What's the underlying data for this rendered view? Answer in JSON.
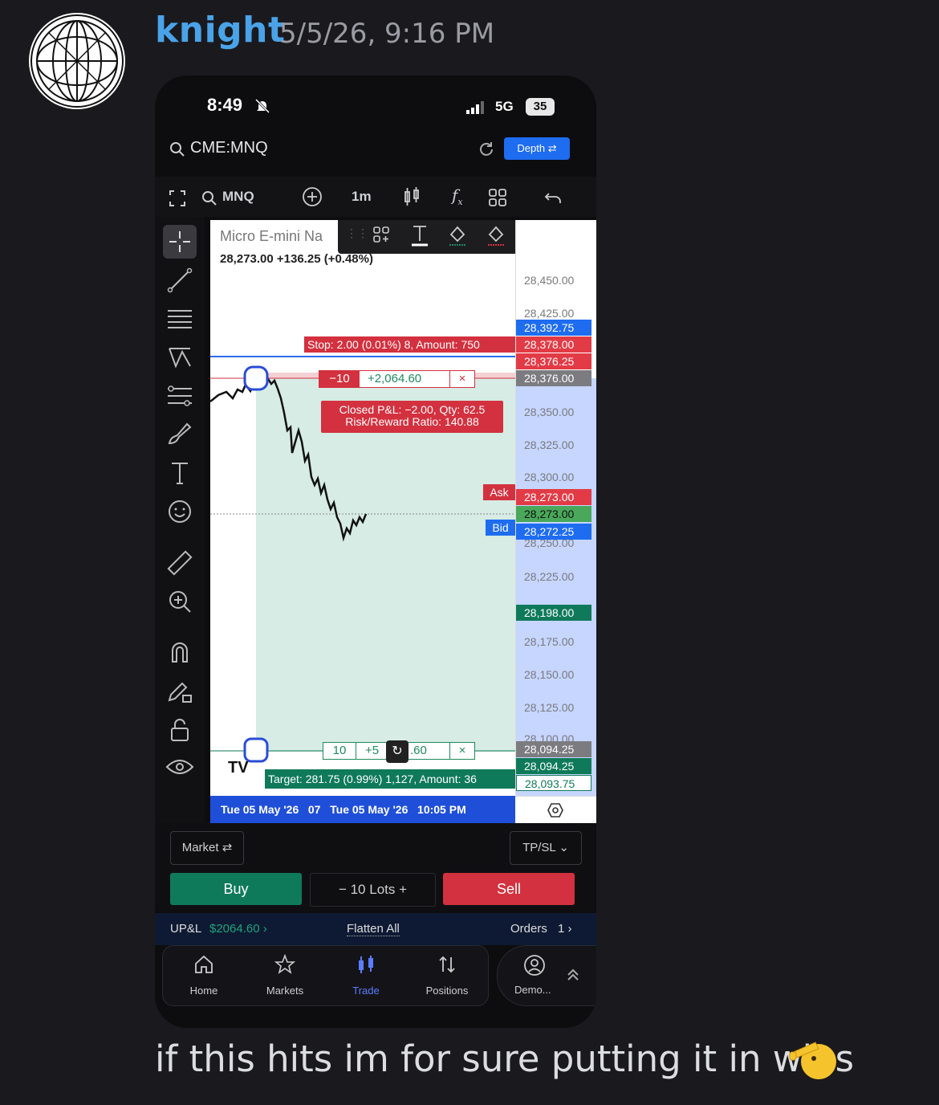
{
  "message": {
    "username": "knight",
    "timestamp": "5/5/26, 9:16 PM",
    "text": "if this hits im for sure putting it in wins"
  },
  "phone": {
    "status": {
      "time": "8:49",
      "network": "5G",
      "battery": "35"
    },
    "header": {
      "symbol": "CME:MNQ",
      "depth_label": "Depth"
    },
    "toolbar": {
      "symbol": "MNQ",
      "interval": "1m"
    },
    "chart": {
      "title": "Micro E-mini Na",
      "quote": "28,273.00 +136.25 (+0.48%)",
      "price_ticks": [
        "28,450.00",
        "28,425.00",
        "28,350.00",
        "28,325.00",
        "28,300.00",
        "28,250.00",
        "28,225.00",
        "28,175.00",
        "28,150.00",
        "28,125.00",
        "28,100.00"
      ],
      "tags": {
        "blue_line": "28,392.75",
        "stop": "28,378.00",
        "stop2": "28,376.25",
        "entry": "28,376.00",
        "ask": "28,273.00",
        "last": "28,273.00",
        "bid": "28,272.25",
        "level": "28,198.00",
        "target_gray": "28,094.25",
        "target_green": "28,094.25",
        "target_outline": "28,093.75"
      },
      "ask_label": "Ask",
      "bid_label": "Bid",
      "stop_label": "Stop: 2.00 (0.01%) 8, Amount: 750",
      "position_qty": "−10",
      "position_pnl": "+2,064.60",
      "closed_pnl_line1": "Closed P&L: −2.00, Qty: 62.5",
      "closed_pnl_line2": "Risk/Reward Ratio: 140.88",
      "target_qty": "10",
      "target_pnl_a": "+5",
      "target_pnl_b": ".60",
      "target_label": "Target: 281.75 (0.99%) 1,127, Amount: 36",
      "date_bar": "Tue 05 May '26   07   Tue 05 May '26   10:05 PM"
    },
    "order": {
      "market_label": "Market ⇄",
      "tpsl_label": "TP/SL ⌄",
      "buy_label": "Buy",
      "lots_label": "−   10  Lots  +",
      "sell_label": "Sell"
    },
    "pnl_bar": {
      "upnl_label": "UP&L",
      "upnl_value": "$2064.60 ›",
      "flatten_label": "Flatten All",
      "orders_label": "Orders",
      "orders_count": "1 ›"
    },
    "nav": {
      "home": "Home",
      "markets": "Markets",
      "trade": "Trade",
      "positions": "Positions",
      "demo": "Demo..."
    }
  },
  "colors": {
    "username": "#4aa3e8",
    "buy": "#0f7a5a",
    "sell": "#d3313f",
    "accent_blue": "#1e6cf0",
    "upnl": "#1fa37a",
    "target_zone": "#d6ece4"
  }
}
